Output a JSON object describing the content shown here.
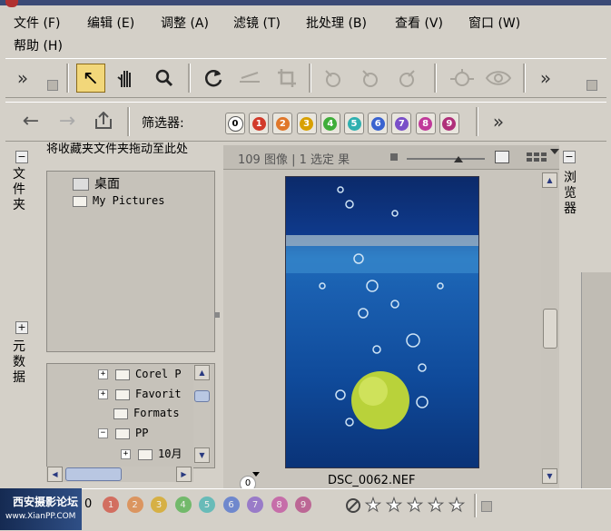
{
  "menu": {
    "file": "文件 (F)",
    "edit": "编辑 (E)",
    "adjust": "调整 (A)",
    "filter": "滤镜 (T)",
    "batch": "批处理 (B)",
    "view": "查看 (V)",
    "window": "窗口 (W)",
    "help": "帮助 (H)"
  },
  "toolbar2": {
    "filter_label": "筛选器:",
    "chips": [
      {
        "label": "0",
        "color": "#ffffff"
      },
      {
        "label": "1",
        "color": "#d23a2a"
      },
      {
        "label": "2",
        "color": "#e0772a"
      },
      {
        "label": "3",
        "color": "#d8a000"
      },
      {
        "label": "4",
        "color": "#3fae3a"
      },
      {
        "label": "5",
        "color": "#2fb0b0"
      },
      {
        "label": "6",
        "color": "#3a63d0"
      },
      {
        "label": "7",
        "color": "#7a4fc8"
      },
      {
        "label": "8",
        "color": "#c03a9a"
      },
      {
        "label": "9",
        "color": "#b0307a"
      }
    ]
  },
  "left_panel": {
    "folders_tab": "文件夹",
    "metadata_tab": "元数据",
    "favorites_hint": "将收藏夹文件夹拖动至此处",
    "favorites": [
      "桌面",
      "My Pictures"
    ],
    "tree": [
      "Corel P",
      "Favorit",
      "Formats",
      "PP",
      "10月"
    ]
  },
  "browser": {
    "status": "109 图像 | 1 选定 果",
    "tab": "浏览器",
    "filename": "DSC_0062.NEF",
    "rating_badge": "0"
  },
  "bottom": {
    "rating": "0",
    "chips": [
      "1",
      "2",
      "3",
      "4",
      "5",
      "6",
      "7",
      "8",
      "9"
    ],
    "chip_colors": [
      "#d23a2a",
      "#e0772a",
      "#d8a000",
      "#3fae3a",
      "#2fb0b0",
      "#3a63d0",
      "#7a4fc8",
      "#c03a9a",
      "#b0307a"
    ],
    "watermark": "西安摄影论坛",
    "watermark_url": "www.XianPP.COM"
  }
}
